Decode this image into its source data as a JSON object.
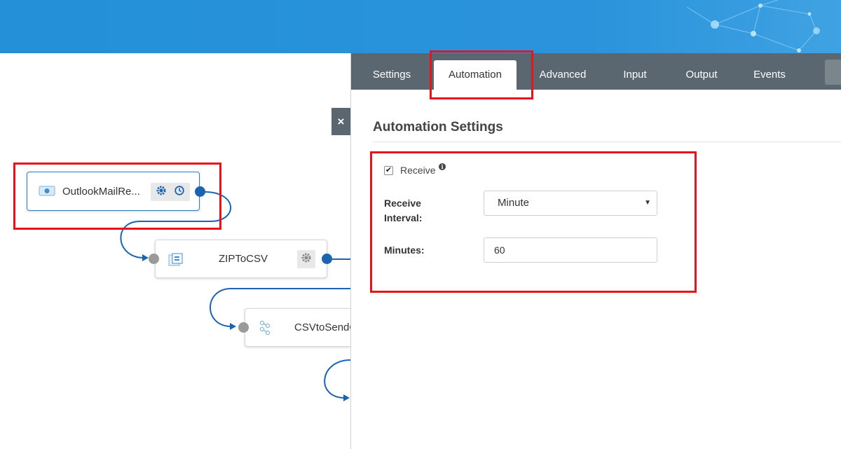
{
  "panel": {
    "tabs": [
      {
        "label": "Settings"
      },
      {
        "label": "Automation"
      },
      {
        "label": "Advanced"
      },
      {
        "label": "Input"
      },
      {
        "label": "Output"
      },
      {
        "label": "Events"
      }
    ],
    "active_tab": "Automation",
    "section_title": "Automation Settings",
    "receive": {
      "label": "Receive",
      "checked": true,
      "check_glyph": "✔",
      "info_glyph": "i"
    },
    "interval": {
      "label_line1": "Receive",
      "label_line2": "Interval:",
      "value": "Minute",
      "caret": "▼"
    },
    "minutes": {
      "label": "Minutes:",
      "value": "60"
    }
  },
  "close_button": {
    "glyph": "×"
  },
  "flow": {
    "nodes": [
      {
        "name": "OutlookMailRe...",
        "icons": [
          "outlook-mail-icon",
          "gear-icon",
          "clock-icon"
        ]
      },
      {
        "name": "ZIPToCSV",
        "icons": [
          "zip-csv-icon",
          "gear-icon"
        ]
      },
      {
        "name": "CSVtoSendC",
        "icons": [
          "csv-send-icon"
        ]
      }
    ]
  },
  "colors": {
    "header_blue": "#2390d8",
    "tab_bar": "#5b6770",
    "highlight_red": "#e8141c",
    "port_blue": "#1b64b4",
    "port_gray": "#9a9a9a"
  }
}
